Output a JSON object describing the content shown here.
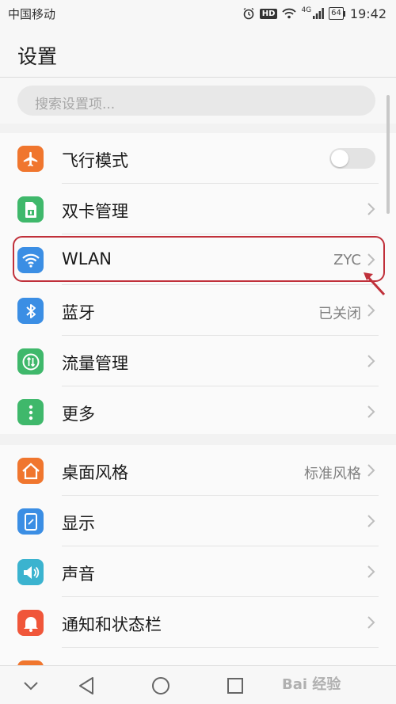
{
  "status_bar": {
    "carrier": "中国移动",
    "hd": "HD",
    "network": "4G",
    "battery": "64",
    "time": "19:42"
  },
  "header": {
    "title": "设置"
  },
  "search": {
    "placeholder": "搜索设置项..."
  },
  "group1": [
    {
      "label": "飞行模式",
      "icon": "airplane-icon",
      "color": "#f0762e",
      "toggle": false
    },
    {
      "label": "双卡管理",
      "icon": "sim-card-icon",
      "color": "#3fb86b"
    },
    {
      "label": "WLAN",
      "icon": "wifi-icon",
      "color": "#3b8ee4",
      "value": "ZYC"
    },
    {
      "label": "蓝牙",
      "icon": "bluetooth-icon",
      "color": "#3b8ee4",
      "value": "已关闭"
    },
    {
      "label": "流量管理",
      "icon": "data-usage-icon",
      "color": "#3fb86b"
    },
    {
      "label": "更多",
      "icon": "more-dots-icon",
      "color": "#3fb86b"
    }
  ],
  "group2": [
    {
      "label": "桌面风格",
      "icon": "home-style-icon",
      "color": "#f0762e",
      "value": "标准风格"
    },
    {
      "label": "显示",
      "icon": "display-icon",
      "color": "#3b8ee4"
    },
    {
      "label": "声音",
      "icon": "sound-icon",
      "color": "#3bb3cf"
    },
    {
      "label": "通知和状态栏",
      "icon": "notification-bell-icon",
      "color": "#f0563a"
    },
    {
      "label": "",
      "icon": "partial-item-icon",
      "color": "#f0762e"
    }
  ],
  "watermark": "Bai 经验"
}
